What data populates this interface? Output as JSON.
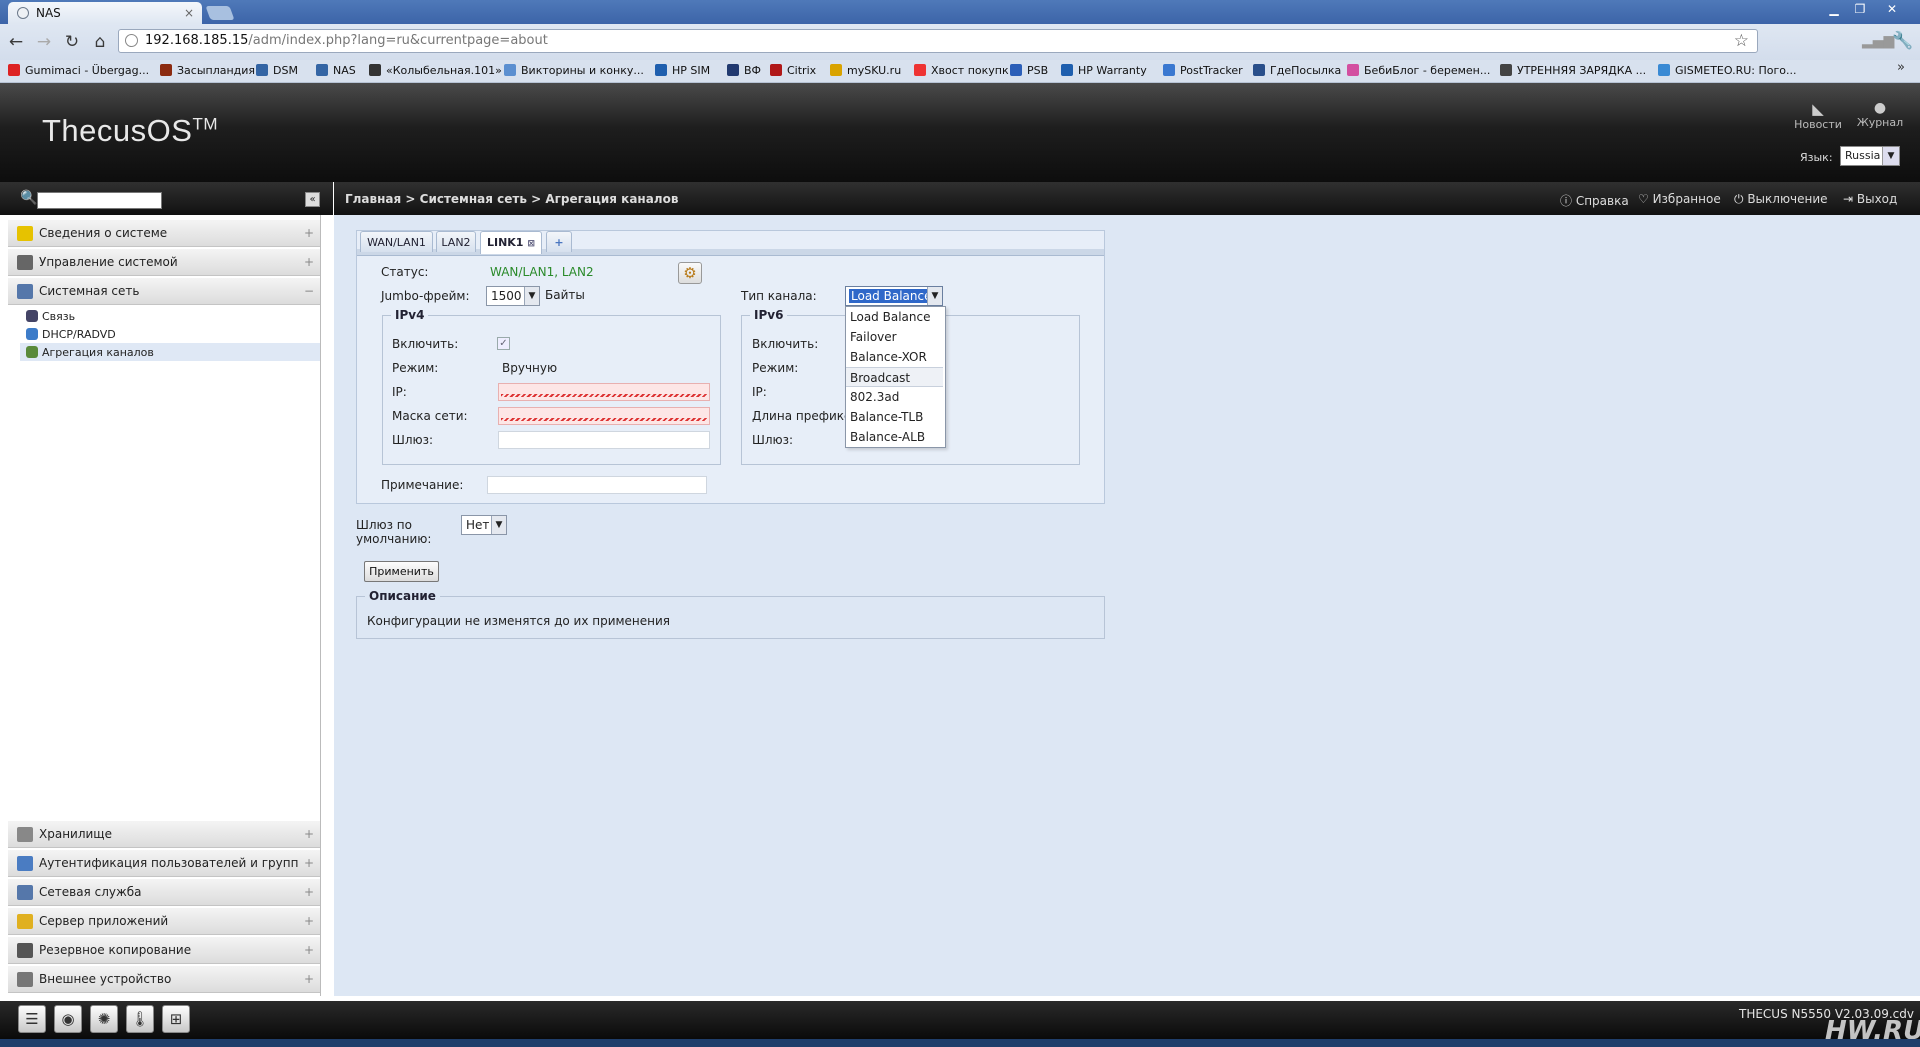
{
  "browser": {
    "tab_title": "NAS",
    "tab_close": "×",
    "url_host": "192.168.185.15",
    "url_path": "/adm/index.php?lang=ru&currentpage=about",
    "bookmarks": [
      {
        "label": "Gumimaci - Übergag...",
        "color": "#d22"
      },
      {
        "label": "Засыпландия",
        "color": "#8b2a10"
      },
      {
        "label": "DSM",
        "color": "#3465a4"
      },
      {
        "label": "NAS",
        "color": "#3465a4"
      },
      {
        "label": "«Колыбельная.101»",
        "color": "#333"
      },
      {
        "label": "Викторины и конку...",
        "color": "#5b8fd0"
      },
      {
        "label": "HP SIM",
        "color": "#1f5fae"
      },
      {
        "label": "ВФ",
        "color": "#223a70"
      },
      {
        "label": "Citrix",
        "color": "#b01818"
      },
      {
        "label": "mySKU.ru",
        "color": "#d9a300"
      },
      {
        "label": "Хвост покупк",
        "color": "#e33"
      },
      {
        "label": "PSB",
        "color": "#2c5fb8"
      },
      {
        "label": "HP Warranty",
        "color": "#1f5fae"
      },
      {
        "label": "PostTracker",
        "color": "#3a78d0"
      },
      {
        "label": "ГдеПосылка",
        "color": "#2a4f8a"
      },
      {
        "label": "БебиБлог - беремен...",
        "color": "#d34fa0"
      },
      {
        "label": "УТРЕННЯЯ ЗАРЯДКА ...",
        "color": "#444"
      },
      {
        "label": "GISMETEO.RU: Пого...",
        "color": "#3a8ad4"
      }
    ],
    "more": "»"
  },
  "header": {
    "logo": "ThecusOS",
    "logo_tm": "TM",
    "news_label": "Новости",
    "log_label": "Журнал",
    "lang_label": "Язык:",
    "lang_value": "Russia"
  },
  "sidebar": {
    "collapse": "«",
    "sections": [
      {
        "label": "Сведения о системе",
        "pm": "+",
        "color": "#e6c200"
      },
      {
        "label": "Управление системой",
        "pm": "+",
        "color": "#666"
      },
      {
        "label": "Системная сеть",
        "pm": "−",
        "color": "#5577aa"
      },
      {
        "label": "Хранилище",
        "pm": "+",
        "color": "#888"
      },
      {
        "label": "Аутентификация пользователей и групп",
        "pm": "+",
        "color": "#4a7cc2"
      },
      {
        "label": "Сетевая служба",
        "pm": "+",
        "color": "#5577aa"
      },
      {
        "label": "Сервер приложений",
        "pm": "+",
        "color": "#e0b020"
      },
      {
        "label": "Резервное копирование",
        "pm": "+",
        "color": "#555"
      },
      {
        "label": "Внешнее устройство",
        "pm": "+",
        "color": "#777"
      }
    ],
    "sub_items": [
      {
        "label": "Связь",
        "color": "#446"
      },
      {
        "label": "DHCP/RADVD",
        "color": "#3d7cc9"
      },
      {
        "label": "Агрегация каналов",
        "color": "#5a8a3a"
      }
    ]
  },
  "topbar": {
    "breadcrumb": "Главная > Системная сеть > Агрегация каналов",
    "help": "Справка",
    "favorites": "Избранное",
    "shutdown": "Выключение",
    "logout": "Выход"
  },
  "tabs": [
    {
      "label": "WAN/LAN1"
    },
    {
      "label": "LAN2"
    },
    {
      "label": "LINK1"
    },
    {
      "label": "+"
    }
  ],
  "form": {
    "status_label": "Статус:",
    "status_value": "WAN/LAN1, LAN2",
    "jumbo_label": "Jumbo-фрейм:",
    "jumbo_value": "1500",
    "jumbo_unit": "Байты",
    "link_type_label": "Тип канала:",
    "link_type_value": "Load Balance",
    "link_type_options": [
      "Load Balance",
      "Failover",
      "Balance-XOR",
      "Broadcast",
      "802.3ad",
      "Balance-TLB",
      "Balance-ALB"
    ],
    "link_type_hover": "Broadcast",
    "ipv4": {
      "legend": "IPv4",
      "enable_label": "Включить:",
      "enable_checked": true,
      "mode_label": "Режим:",
      "mode_value": "Вручную",
      "ip_label": "IP:",
      "mask_label": "Маска сети:",
      "gateway_label": "Шлюз:"
    },
    "ipv6": {
      "legend": "IPv6",
      "enable_label": "Включить:",
      "mode_label": "Режим:",
      "ip_label": "IP:",
      "prefix_label": "Длина префикса",
      "gateway_label": "Шлюз:"
    },
    "note_label": "Примечание:",
    "default_gw_label_1": "Шлюз по",
    "default_gw_label_2": "умолчанию:",
    "default_gw_value": "Нет",
    "apply_label": "Применить"
  },
  "description": {
    "legend": "Описание",
    "text": "Конфигурации не изменятся до их применения"
  },
  "footer": {
    "version": "THECUS N5550 V2.03.09.cdv",
    "watermark": "HW.RU"
  }
}
